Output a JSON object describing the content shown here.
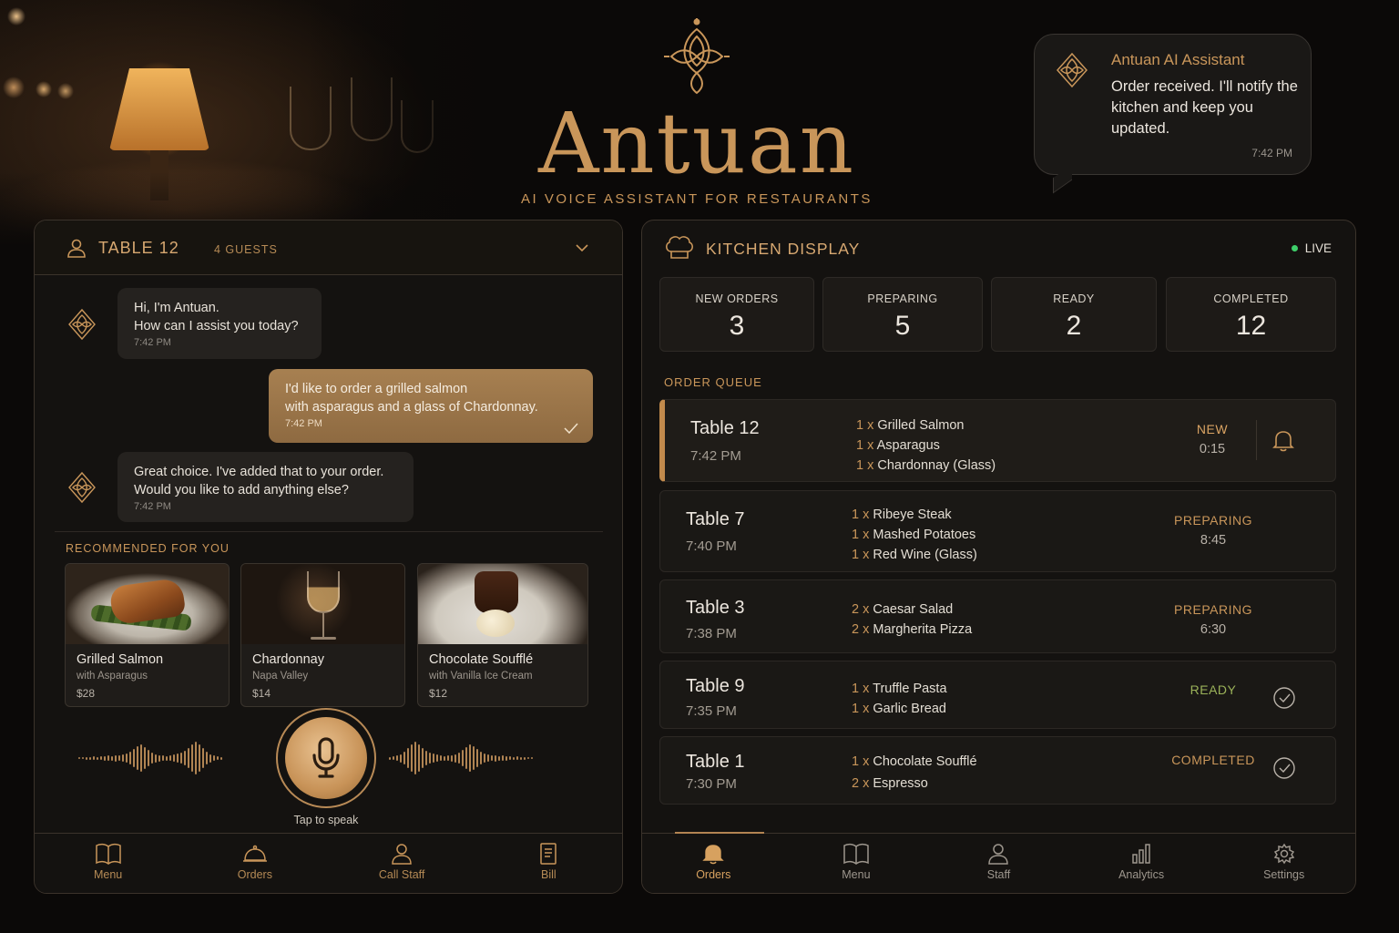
{
  "brand": {
    "name": "Antuan",
    "tagline": "AI VOICE ASSISTANT FOR RESTAURANTS"
  },
  "notification": {
    "title": "Antuan AI Assistant",
    "message": "Order received. I'll notify the kitchen and keep you updated.",
    "time": "7:42 PM"
  },
  "table_panel": {
    "table": "TABLE 12",
    "guests": "4 GUESTS",
    "messages": [
      {
        "from": "bot",
        "text": "Hi, I'm Antuan.\nHow can I assist you today?",
        "time": "7:42 PM"
      },
      {
        "from": "user",
        "text": "I'd like to order a grilled salmon\nwith asparagus and a glass of Chardonnay.",
        "time": "7:42 PM"
      },
      {
        "from": "bot",
        "text": "Great choice. I've added that to your order.\nWould you like to add anything else?",
        "time": "7:42 PM"
      }
    ],
    "recommended_label": "RECOMMENDED FOR YOU",
    "recommendations": [
      {
        "name": "Grilled Salmon",
        "sub": "with Asparagus",
        "price": "$28"
      },
      {
        "name": "Chardonnay",
        "sub": "Napa Valley",
        "price": "$14"
      },
      {
        "name": "Chocolate Soufflé",
        "sub": "with Vanilla Ice Cream",
        "price": "$12"
      }
    ],
    "mic_label": "Tap to speak",
    "nav": [
      {
        "label": "Menu",
        "icon": "book-icon"
      },
      {
        "label": "Orders",
        "icon": "cloche-icon"
      },
      {
        "label": "Call Staff",
        "icon": "person-icon"
      },
      {
        "label": "Bill",
        "icon": "receipt-icon"
      }
    ]
  },
  "kitchen": {
    "title": "KITCHEN DISPLAY",
    "live": "LIVE",
    "stats": [
      {
        "label": "NEW ORDERS",
        "value": "3"
      },
      {
        "label": "PREPARING",
        "value": "5"
      },
      {
        "label": "READY",
        "value": "2"
      },
      {
        "label": "COMPLETED",
        "value": "12"
      }
    ],
    "queue_label": "ORDER QUEUE",
    "orders": [
      {
        "table": "Table 12",
        "time": "7:42 PM",
        "items": [
          {
            "qty": "1",
            "name": "Grilled Salmon"
          },
          {
            "qty": "1",
            "name": "Asparagus"
          },
          {
            "qty": "1",
            "name": "Chardonnay (Glass)"
          }
        ],
        "status": "NEW",
        "elapsed": "0:15"
      },
      {
        "table": "Table 7",
        "time": "7:40 PM",
        "items": [
          {
            "qty": "1",
            "name": "Ribeye Steak"
          },
          {
            "qty": "1",
            "name": "Mashed Potatoes"
          },
          {
            "qty": "1",
            "name": "Red Wine (Glass)"
          }
        ],
        "status": "PREPARING",
        "elapsed": "8:45"
      },
      {
        "table": "Table 3",
        "time": "7:38 PM",
        "items": [
          {
            "qty": "2",
            "name": "Caesar Salad"
          },
          {
            "qty": "2",
            "name": "Margherita Pizza"
          }
        ],
        "status": "PREPARING",
        "elapsed": "6:30"
      },
      {
        "table": "Table 9",
        "time": "7:35 PM",
        "items": [
          {
            "qty": "1",
            "name": "Truffle Pasta"
          },
          {
            "qty": "1",
            "name": "Garlic Bread"
          }
        ],
        "status": "READY",
        "elapsed": ""
      },
      {
        "table": "Table 1",
        "time": "7:30 PM",
        "items": [
          {
            "qty": "1",
            "name": "Chocolate Soufflé"
          },
          {
            "qty": "2",
            "name": "Espresso"
          }
        ],
        "status": "COMPLETED",
        "elapsed": ""
      }
    ],
    "nav": [
      {
        "label": "Orders",
        "icon": "bell-icon"
      },
      {
        "label": "Menu",
        "icon": "book-icon"
      },
      {
        "label": "Staff",
        "icon": "person-icon"
      },
      {
        "label": "Analytics",
        "icon": "bar-chart-icon"
      },
      {
        "label": "Settings",
        "icon": "gear-icon"
      }
    ]
  },
  "colors": {
    "accent_gold": "#c9965a",
    "live_green": "#3ecf6a",
    "ready_green": "#9bb259"
  }
}
